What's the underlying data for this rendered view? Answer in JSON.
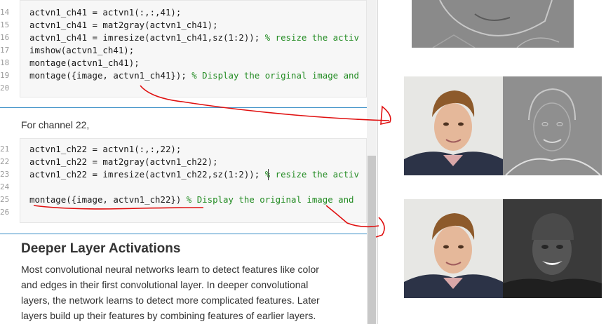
{
  "code_block_1": {
    "lines": [
      {
        "num": "14",
        "code": "actvn1_ch41 = actvn1(:,:,41);",
        "comment": ""
      },
      {
        "num": "15",
        "code": "actvn1_ch41 = mat2gray(actvn1_ch41);",
        "comment": ""
      },
      {
        "num": "16",
        "code": "actvn1_ch41 = imresize(actvn1_ch41,sz(1:2)); ",
        "comment": "% resize the activ"
      },
      {
        "num": "17",
        "code": "imshow(actvn1_ch41);",
        "comment": ""
      },
      {
        "num": "18",
        "code": "montage(actvn1_ch41);",
        "comment": ""
      },
      {
        "num": "19",
        "code": "montage({image, actvn1_ch41}); ",
        "comment": "% Display the original image and"
      },
      {
        "num": "20",
        "code": "",
        "comment": ""
      }
    ]
  },
  "text_channel": "For channel 22,",
  "code_block_2": {
    "lines": [
      {
        "num": "21",
        "code": "actvn1_ch22 = actvn1(:,:,22);",
        "comment": ""
      },
      {
        "num": "22",
        "code": "actvn1_ch22 = mat2gray(actvn1_ch22);",
        "comment": ""
      },
      {
        "num": "23",
        "code": "actvn1_ch22 = imresize(actvn1_ch22,sz(1:2)); ",
        "comment": "% resize the activ"
      },
      {
        "num": "24",
        "code": "",
        "comment": ""
      },
      {
        "num": "25",
        "code": "montage({image, actvn1_ch22}) ",
        "comment": "% Display the original image and"
      },
      {
        "num": "26",
        "code": "",
        "comment": ""
      }
    ]
  },
  "heading": "Deeper Layer Activations",
  "paragraph": "Most convolutional neural networks learn to detect features like color and edges in their first convolutional layer. In deeper convolutional layers, the network learns to detect more complicated features. Later layers build up their features by combining features of earlier layers.",
  "colors": {
    "comment": "#228b22",
    "divider": "#3b8fc6",
    "annotation": "#e01010"
  },
  "images": [
    {
      "name": "activation-edge-image-top",
      "description": "grayscale edge activation"
    },
    {
      "name": "montage-channel-41",
      "left": "face photo",
      "right": "edge activation"
    },
    {
      "name": "montage-channel-22",
      "left": "face photo",
      "right": "dark activation"
    }
  ]
}
